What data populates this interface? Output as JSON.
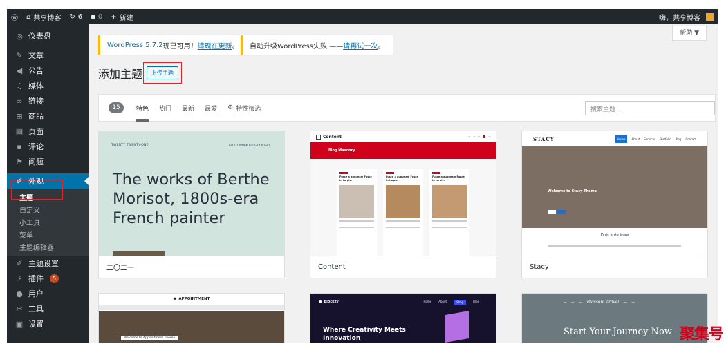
{
  "adminbar": {
    "site_name": "共享博客",
    "updates_count": "6",
    "comments_count": "0",
    "new_label": "新建",
    "greeting": "嗨，共享博客"
  },
  "sidebar": {
    "items": [
      {
        "label": "仪表盘"
      },
      {
        "label": "文章"
      },
      {
        "label": "公告"
      },
      {
        "label": "媒体"
      },
      {
        "label": "链接"
      },
      {
        "label": "商品"
      },
      {
        "label": "页面"
      },
      {
        "label": "评论"
      },
      {
        "label": "问题"
      },
      {
        "label": "外观"
      },
      {
        "label": "主题设置"
      },
      {
        "label": "插件",
        "badge": "5"
      },
      {
        "label": "用户"
      },
      {
        "label": "工具"
      },
      {
        "label": "设置"
      }
    ],
    "submenu": [
      "主题",
      "自定义",
      "小工具",
      "菜单",
      "主题编辑器"
    ]
  },
  "help_label": "帮助 ▼",
  "notices": {
    "update_link": "WordPress 5.7.2",
    "update_text": "现已可用！",
    "update_now": "请现在更新",
    "failed_text": "自动升级WordPress失败 —— ",
    "retry": "请再试一次",
    "period": "。"
  },
  "page": {
    "title": "添加主题",
    "upload_button": "上传主题"
  },
  "filter": {
    "count": "15",
    "tabs": [
      "特色",
      "热门",
      "最新",
      "最爱",
      "特性筛选"
    ],
    "search_placeholder": "搜索主题..."
  },
  "themes": [
    {
      "name": "二〇二一",
      "headline": "The works of Berthe Morisot, 1800s-era French painter",
      "topline": "TWENTY TWENTY-ONE",
      "nav": "ABOUT   WORK   BLOG   CONTACT"
    },
    {
      "name": "Content",
      "logo": "Content",
      "banner": "Blog Masonry",
      "post_title": "Fusce a augueam Fusce in turpis."
    },
    {
      "name": "Stacy",
      "logo": "STACY",
      "nav": [
        "Home",
        "About",
        "Services",
        "Portfolio",
        "Blog",
        "Contact"
      ],
      "hero": "Welcome to Stacy Theme",
      "section": "Duis aute irure"
    },
    {
      "logo": "APPOINTMENT",
      "hero_badge": "Welcome to Appointment Theme"
    },
    {
      "logo": "Blockzy",
      "nav": [
        "Home",
        "About",
        "Shop",
        "Blog"
      ],
      "headline_1": "Where Creativity Meets",
      "headline_2": "Innovation"
    },
    {
      "logo": "Blossom Travel",
      "headline": "Start Your Journey Now"
    }
  ],
  "watermark": "聚集号",
  "colors": {
    "admin_dark": "#23282d",
    "accent_blue": "#0073aa",
    "notice_yellow": "#ffb900",
    "highlight_red": "#e0262b",
    "badge_orange": "#ca4a1f"
  }
}
